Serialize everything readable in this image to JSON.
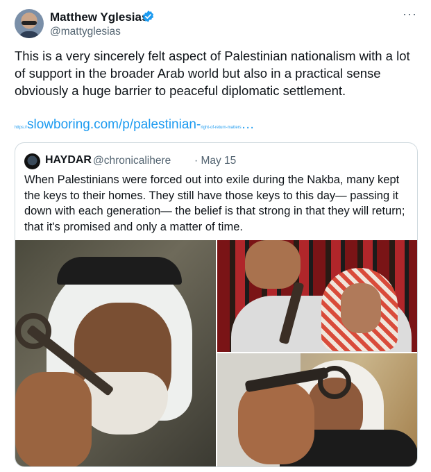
{
  "author": {
    "name": "Matthew Yglesias",
    "handle": "@mattyglesias",
    "verified": true,
    "avatar_icon": "profile-photo"
  },
  "menu_icon": "···",
  "tweet": {
    "text": "This is a very sincerely felt aspect of Palestinian nationalism with a lot of support in the broader Arab world but also in a practical sense obviously a huge barrier to peaceful diplomatic settlement.",
    "link": {
      "prefix": "https://",
      "main": "slowboring.com/p/palestinian-",
      "suffix": "right-of-return-matters",
      "ellipsis": "…"
    }
  },
  "quote": {
    "name": "HAYDAR",
    "handle": "@chronicalihere",
    "date": "· May 15",
    "text": "When Palestinians were forced out into exile during the Nakba, many kept the keys to their homes. They still have those keys to this day— passing it down with each generation— the belief is that strong in that they will return; that it's promised and only a matter of time."
  },
  "colors": {
    "link": "#1d9bf0",
    "secondary_text": "#536471",
    "border": "#cfd9de",
    "verified_badge": "#1d9bf0"
  }
}
